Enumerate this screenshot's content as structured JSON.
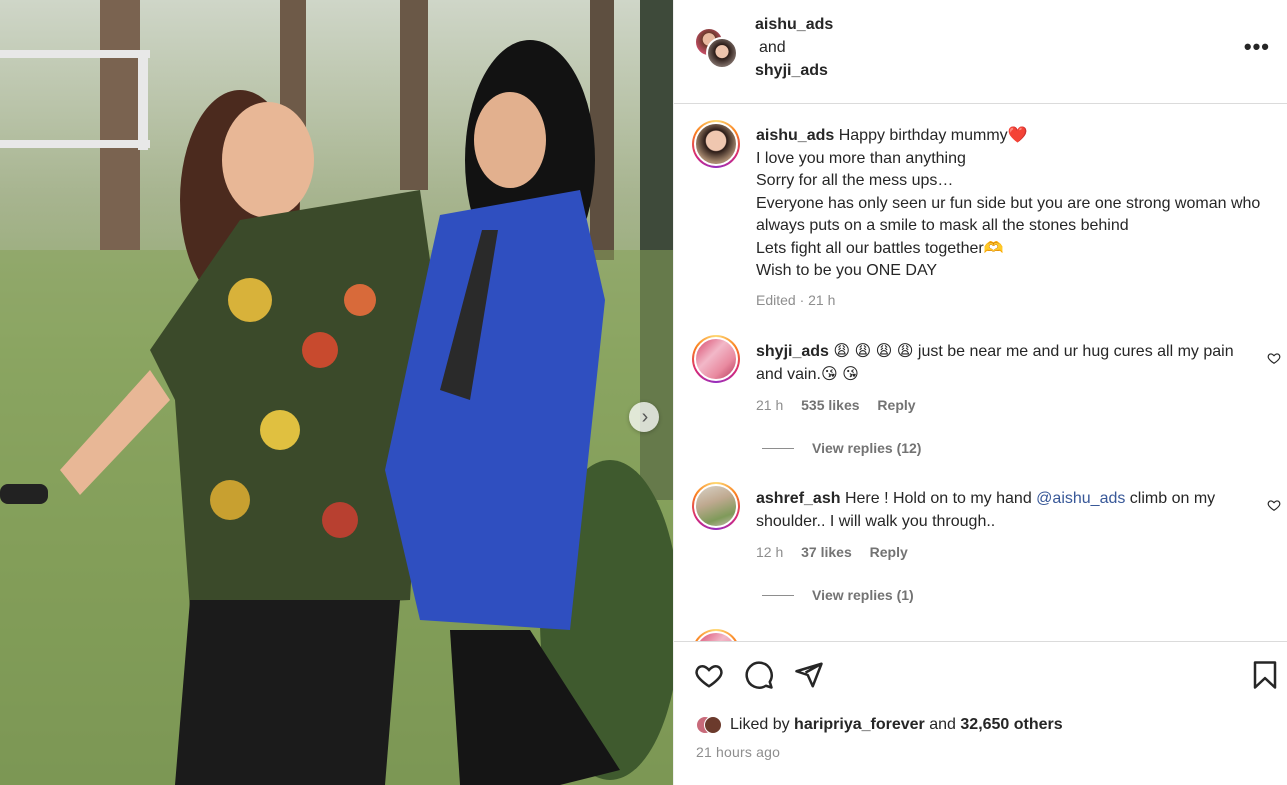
{
  "header": {
    "user1": "aishu_ads",
    "and_label": "and",
    "user2": "shyji_ads",
    "more_icon": "more-horizontal-icon"
  },
  "caption": {
    "user": "aishu_ads",
    "lines": [
      "Happy birthday mummy❤️",
      "I love you more than anything",
      "Sorry for all the mess ups…",
      "Everyone has only seen ur fun side but you are one strong woman who always puts on a smile to mask all the stones behind",
      "Lets fight all our battles together🫶",
      "Wish to be you ONE DAY"
    ],
    "meta": "Edited · 21 h"
  },
  "comments": [
    {
      "user": "shyji_ads",
      "text": "😩 😩 😩 😩 just be near me and ur hug cures all my pain and vain.😘 😘",
      "time": "21 h",
      "likes": "535 likes",
      "reply": "Reply",
      "view_replies": "View replies (12)"
    },
    {
      "user": "ashref_ash",
      "text_before": "Here ! Hold on to my hand ",
      "mention": "@aishu_ads",
      "text_after": " climb on my shoulder.. I will walk you through..",
      "time": "12 h",
      "likes": "37 likes",
      "reply": "Reply",
      "view_replies": "View replies (1)"
    }
  ],
  "actions": {
    "like_icon": "heart-icon",
    "comment_icon": "comment-icon",
    "share_icon": "share-icon",
    "save_icon": "bookmark-icon"
  },
  "likes": {
    "prefix": "Liked by",
    "user": "haripriya_forever",
    "middle": "and",
    "others": "32,650 others"
  },
  "time_ago": "21 hours ago",
  "media": {
    "next_icon": "chevron-right-icon"
  },
  "colors": {
    "mention": "#385898",
    "muted": "#8e8e8e",
    "text": "#262626"
  }
}
